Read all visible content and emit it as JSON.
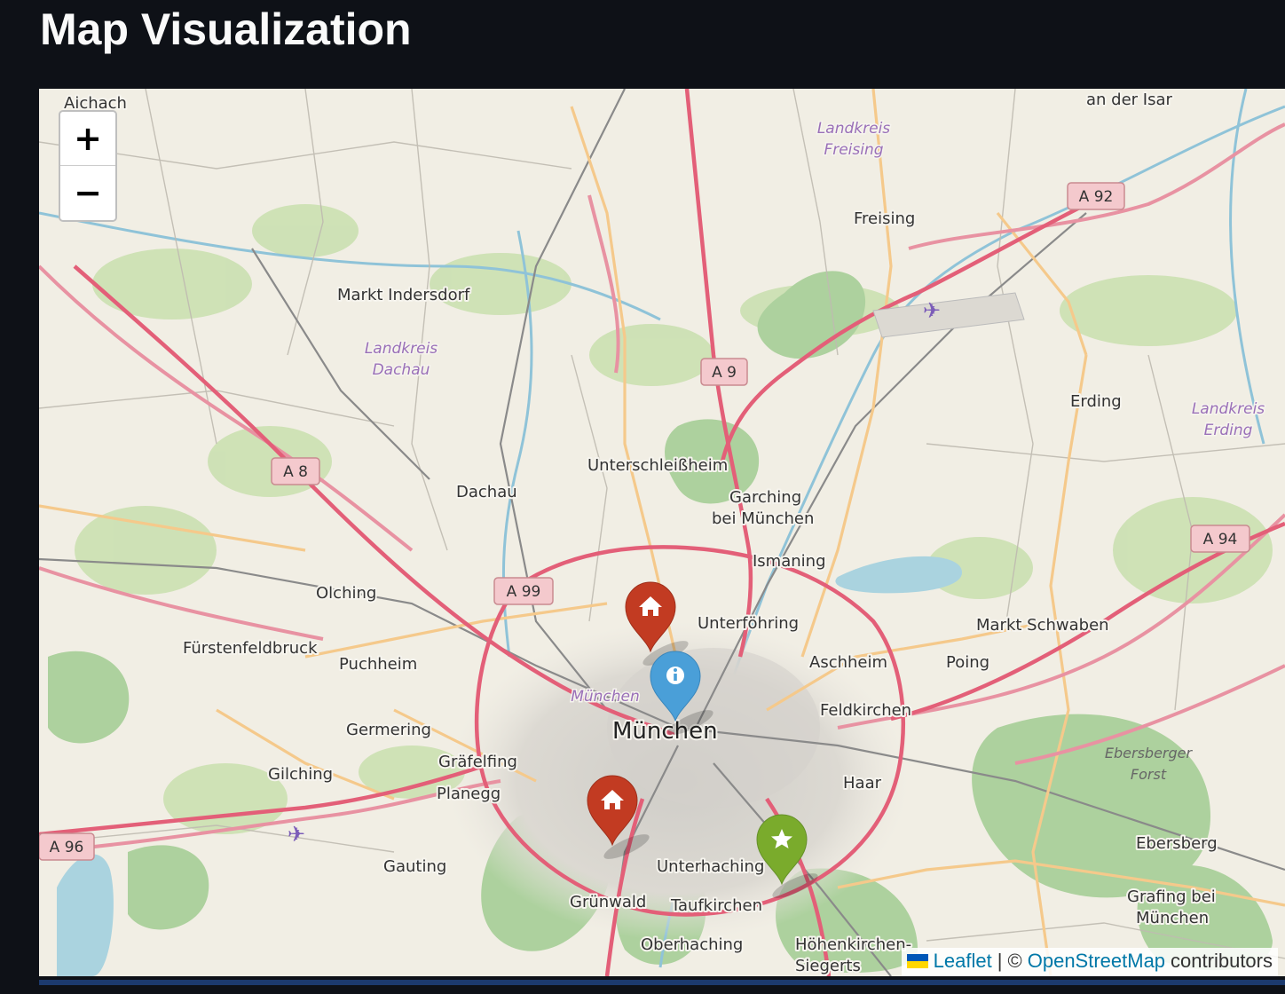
{
  "page": {
    "title": "Map Visualization"
  },
  "map": {
    "zoom_in_label": "+",
    "zoom_out_label": "−",
    "attribution": {
      "leaflet": "Leaflet",
      "separator": "| ©",
      "osm": "OpenStreetMap",
      "suffix": "contributors"
    },
    "place_labels": {
      "aichach": "Aichach",
      "an_der_isar": "an der Isar",
      "freising": "Freising",
      "markt_indersdorf": "Markt Indersdorf",
      "erding": "Erding",
      "unterschleissheim": "Unterschleißheim",
      "dachau": "Dachau",
      "garching_1": "Garching",
      "garching_2": "bei München",
      "ismaning": "Ismaning",
      "olching": "Olching",
      "unterfoehring": "Unterföhring",
      "markt_schwaben": "Markt Schwaben",
      "fuerstenfeldbruck": "Fürstenfeldbruck",
      "puchheim": "Puchheim",
      "aschheim": "Aschheim",
      "poing": "Poing",
      "muenchen_district": "München",
      "feldkirchen": "Feldkirchen",
      "germering": "Germering",
      "muenchen": "München",
      "graefelfing": "Gräfelfing",
      "gilching": "Gilching",
      "planegg": "Planegg",
      "haar": "Haar",
      "ebersberg": "Ebersberg",
      "gauting": "Gauting",
      "unterhaching": "Unterhaching",
      "gruenwald": "Grünwald",
      "taufkirchen": "Taufkirchen",
      "grafing_1": "Grafing bei",
      "grafing_2": "München",
      "oberhaching": "Oberhaching",
      "hoehenkirchen_1": "Höhenkirchen-",
      "hoehenkirchen_2": "Siegerts"
    },
    "region_labels": {
      "freising_1": "Landkreis",
      "freising_2": "Freising",
      "dachau_1": "Landkreis",
      "dachau_2": "Dachau",
      "erding_1": "Landkreis",
      "erding_2": "Erding",
      "forst_1": "Ebersberger",
      "forst_2": "Forst"
    },
    "road_shields": {
      "a92": "A 92",
      "a9": "A 9",
      "a8": "A 8",
      "a94": "A 94",
      "a99": "A 99",
      "a96": "A 96"
    },
    "markers": [
      {
        "icon": "home-icon",
        "color": "#c23b22"
      },
      {
        "icon": "info-icon",
        "color": "#4a9fd8"
      },
      {
        "icon": "home-icon",
        "color": "#c23b22"
      },
      {
        "icon": "star-icon",
        "color": "#7aab2c"
      }
    ]
  }
}
